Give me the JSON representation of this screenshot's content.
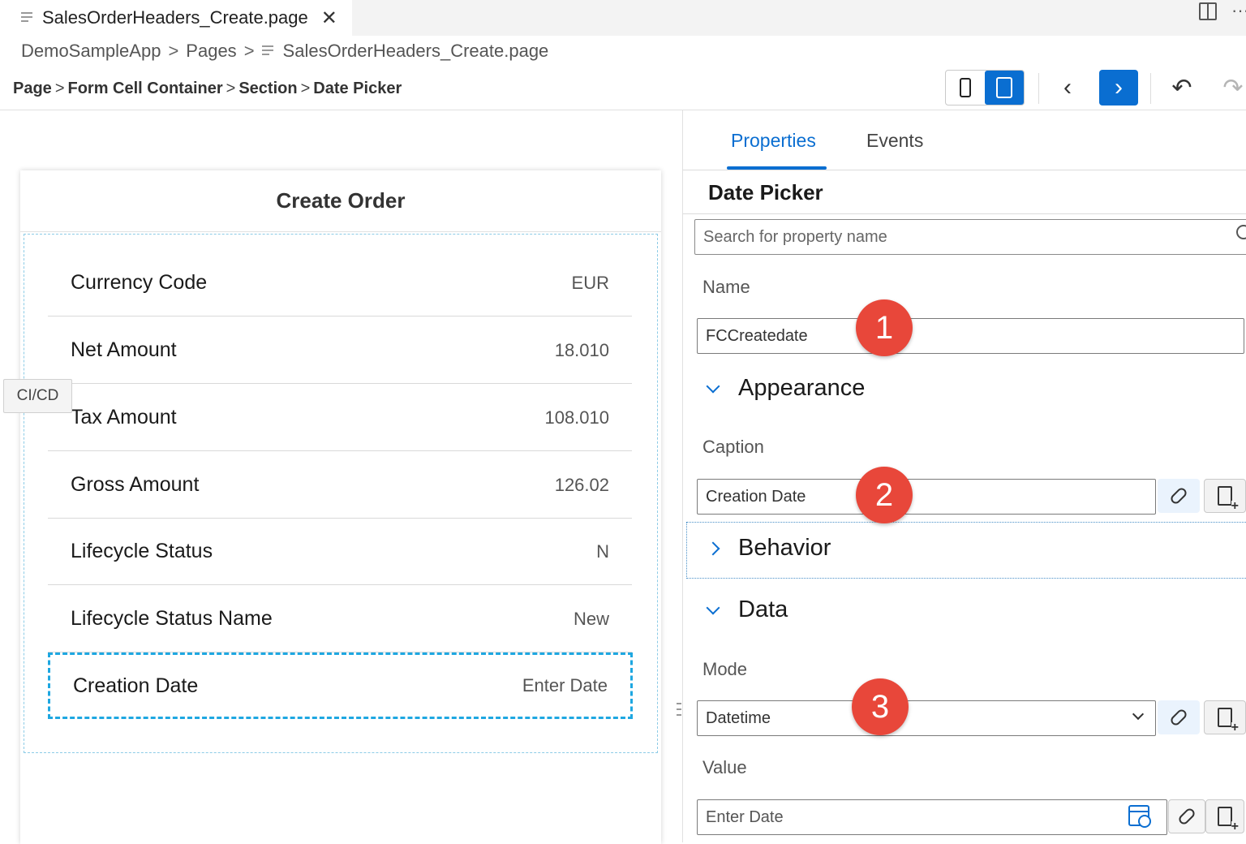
{
  "tab": {
    "title": "SalesOrderHeaders_Create.page",
    "close": "✕"
  },
  "breadcrumbs": [
    "DemoSampleApp",
    "Pages",
    "SalesOrderHeaders_Create.page"
  ],
  "crumb_sep": ">",
  "path": [
    "Page",
    "Form Cell Container",
    "Section",
    "Date Picker"
  ],
  "toolbar": {
    "prev": "‹",
    "next": "›",
    "undo": "↶",
    "redo": "↷",
    "more": "···"
  },
  "preview": {
    "header": "Create Order",
    "rows": [
      {
        "label": "Currency Code",
        "value": "EUR"
      },
      {
        "label": "Net Amount",
        "value": "18.010"
      },
      {
        "label": "Tax Amount",
        "value": "108.010"
      },
      {
        "label": "Gross Amount",
        "value": "126.02"
      },
      {
        "label": "Lifecycle Status",
        "value": "N"
      },
      {
        "label": "Lifecycle Status Name",
        "value": "New"
      },
      {
        "label": "Creation Date",
        "value": "Enter Date"
      }
    ],
    "tooltip": "CI/CD"
  },
  "panel": {
    "tabs": [
      "Properties",
      "Events"
    ],
    "title": "Date Picker",
    "search_placeholder": "Search for property name",
    "name_label": "Name",
    "name_value": "FCCreatedate",
    "appearance": "Appearance",
    "caption_label": "Caption",
    "caption_value": "Creation Date",
    "behavior": "Behavior",
    "data": "Data",
    "mode_label": "Mode",
    "mode_value": "Datetime",
    "value_label": "Value",
    "value_placeholder": "Enter Date"
  },
  "badges": [
    "1",
    "2",
    "3"
  ],
  "colors": {
    "accent": "#0a6ed1",
    "badge": "#e8473a",
    "selection": "#1ea7e1"
  }
}
